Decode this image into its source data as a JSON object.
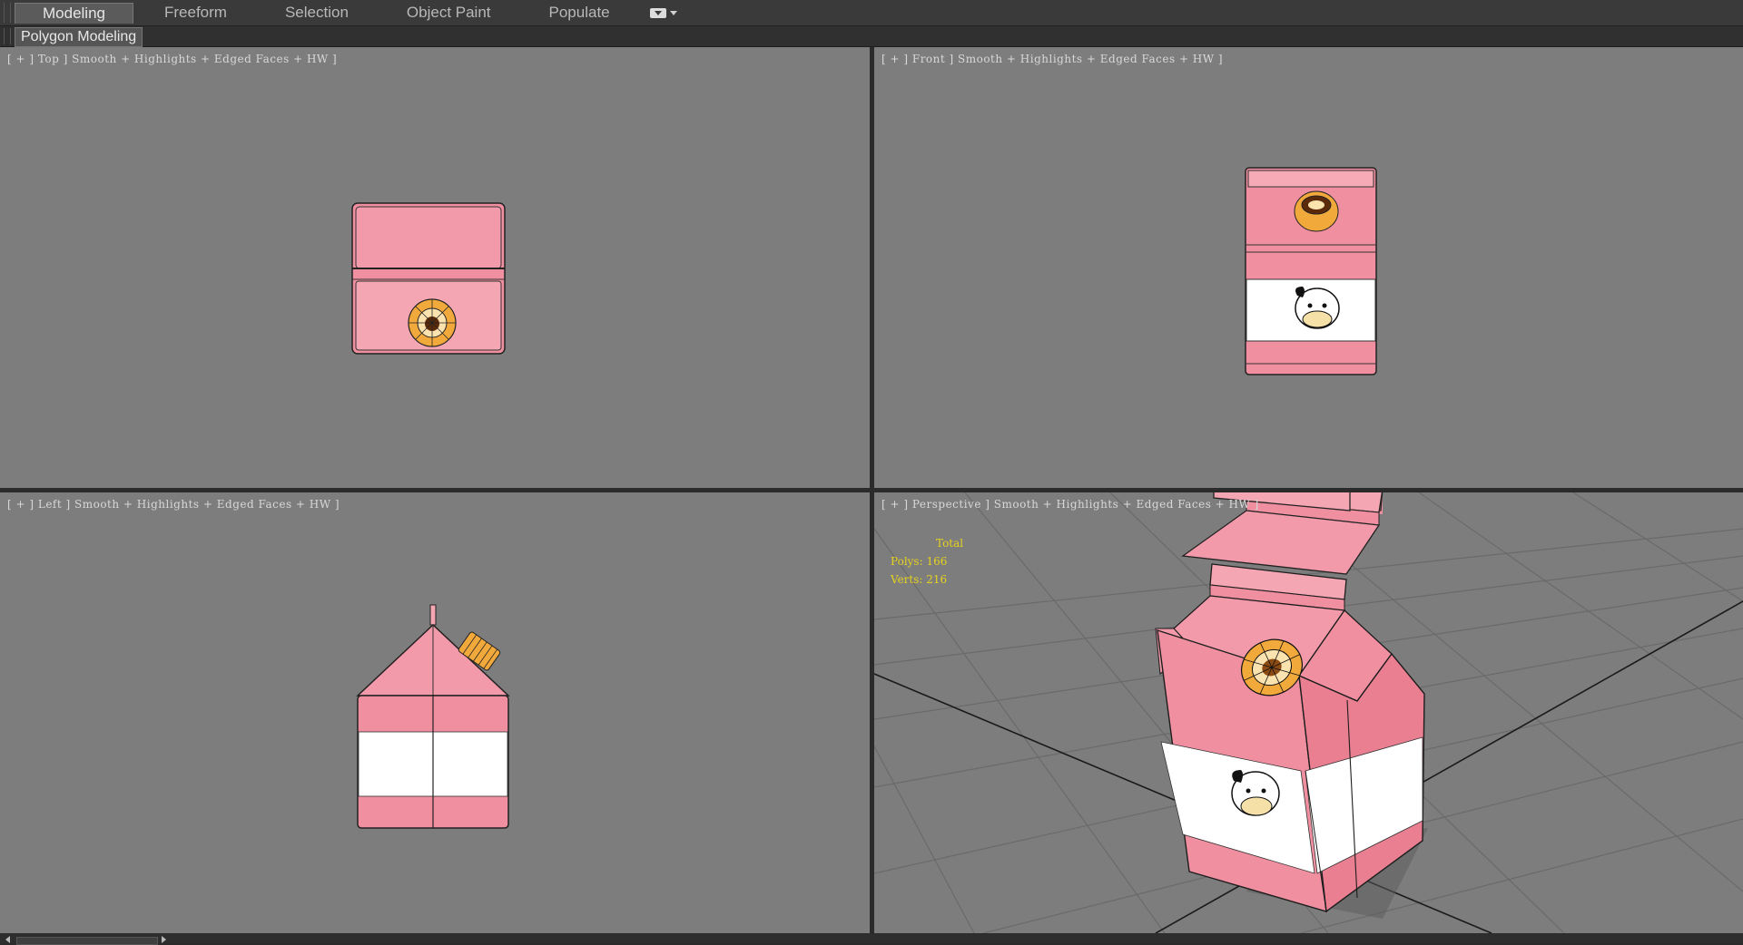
{
  "ribbon": {
    "tabs": [
      {
        "label": "Modeling",
        "active": true
      },
      {
        "label": "Freeform",
        "active": false
      },
      {
        "label": "Selection",
        "active": false
      },
      {
        "label": "Object Paint",
        "active": false
      },
      {
        "label": "Populate",
        "active": false
      }
    ],
    "menu_icon": "ribbon-options-icon",
    "sub_panel": "Polygon Modeling"
  },
  "viewports": {
    "top": {
      "label": "[ + ] Top ] Smooth + Highlights + Edged Faces + HW ]"
    },
    "front": {
      "label": "[ + ] Front ] Smooth + Highlights + Edged Faces + HW ]"
    },
    "left": {
      "label": "[ + ] Left ] Smooth + Highlights + Edged Faces + HW ]"
    },
    "perspective": {
      "label": "[ + ] Perspective ] Smooth + Highlights + Edged Faces + HW ]",
      "stats": {
        "title": "Total",
        "polys": "Polys: 166",
        "verts": "Verts: 216"
      }
    }
  },
  "colors": {
    "viewport_bg": "#7d7d7d",
    "carton_pink": "#f08fa0",
    "carton_pink_light": "#f7b3bf",
    "cap_orange": "#f2a93b",
    "stats_yellow": "#e6d21e"
  }
}
